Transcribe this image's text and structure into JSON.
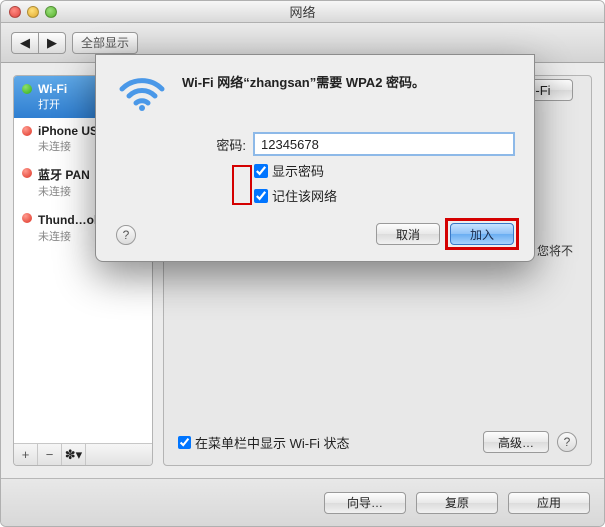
{
  "window": {
    "title": "网络"
  },
  "toolbar": {
    "back_icon": "◀",
    "fwd_icon": "▶",
    "show_all": "全部显示"
  },
  "sidebar": {
    "items": [
      {
        "title": "Wi-Fi",
        "sub": "打开",
        "dot": "green",
        "selected": true
      },
      {
        "title": "iPhone USB",
        "sub": "未连接",
        "dot": "red",
        "selected": false
      },
      {
        "title": "蓝牙 PAN",
        "sub": "未连接",
        "dot": "red",
        "selected": false
      },
      {
        "title": "Thund…ol桥",
        "sub": "未连接",
        "dot": "red",
        "selected": false
      }
    ],
    "add": "+",
    "remove": "−",
    "gear": "✽▾"
  },
  "main": {
    "right_suffix": "-Fi",
    "hint_tail": "，您将不",
    "status_checkbox": "在菜单栏中显示 Wi-Fi 状态",
    "advanced": "高级…",
    "help": "?"
  },
  "footer": {
    "assist": "向导…",
    "revert": "复原",
    "apply": "应用"
  },
  "dialog": {
    "message": "Wi-Fi 网络“zhangsan”需要 WPA2 密码。",
    "password_label": "密码:",
    "password_value": "12345678",
    "show_password": "显示密码",
    "remember": "记住该网络",
    "cancel": "取消",
    "join": "加入",
    "help": "?"
  }
}
